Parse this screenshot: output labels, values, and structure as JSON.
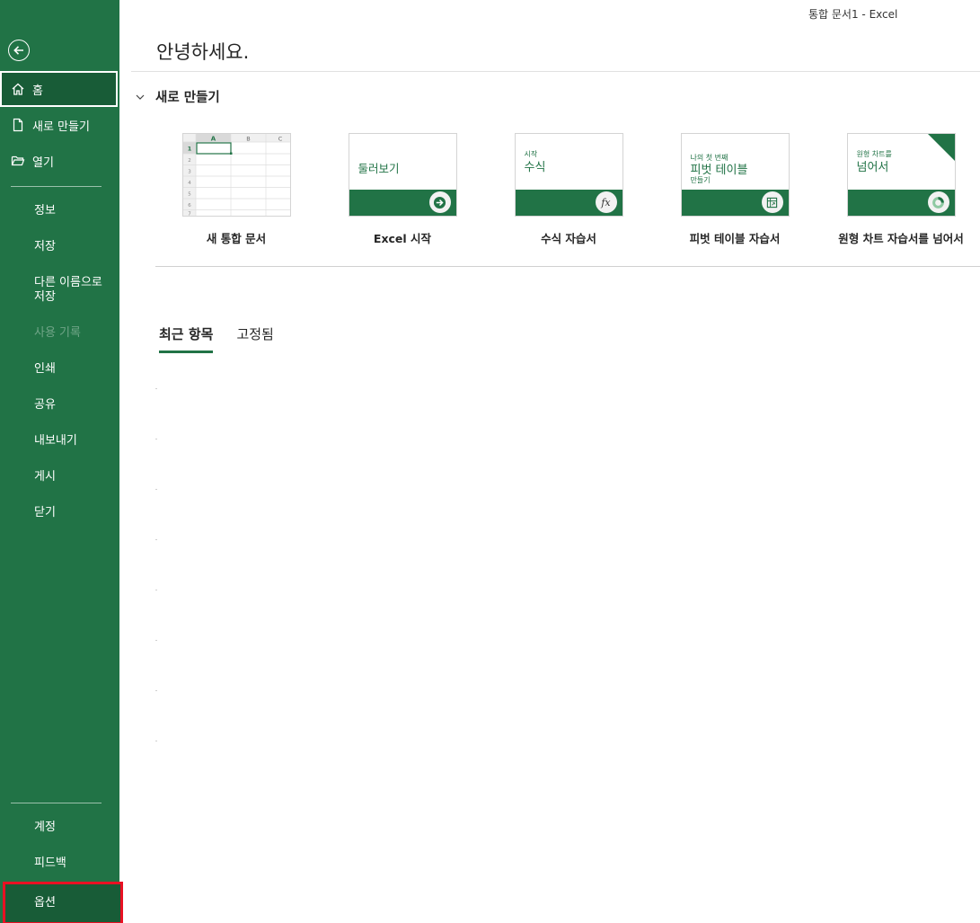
{
  "window": {
    "title": "통합 문서1  -  Excel"
  },
  "sidebar": {
    "top_items": [
      {
        "label": "홈",
        "icon": "home-icon",
        "active": true
      },
      {
        "label": "새로 만들기",
        "icon": "new-document-icon",
        "active": false
      },
      {
        "label": "열기",
        "icon": "open-folder-icon",
        "active": false
      }
    ],
    "mid_items": [
      {
        "label": "정보",
        "enabled": true
      },
      {
        "label": "저장",
        "enabled": true
      },
      {
        "label": "다른 이름으로 저장",
        "enabled": true
      },
      {
        "label": "사용 기록",
        "enabled": false
      },
      {
        "label": "인쇄",
        "enabled": true
      },
      {
        "label": "공유",
        "enabled": true
      },
      {
        "label": "내보내기",
        "enabled": true
      },
      {
        "label": "게시",
        "enabled": true
      },
      {
        "label": "닫기",
        "enabled": true
      }
    ],
    "bottom_items": [
      {
        "label": "계정"
      },
      {
        "label": "피드백"
      },
      {
        "label": "옵션",
        "highlighted": true
      }
    ]
  },
  "main": {
    "greeting": "안녕하세요.",
    "new_section": {
      "title": "새로 만들기"
    },
    "templates": [
      {
        "label": "새 통합 문서",
        "kind": "blank"
      },
      {
        "label": "Excel 시작",
        "kind": "tour",
        "thumb_text": "둘러보기"
      },
      {
        "label": "수식 자습서",
        "kind": "formula",
        "thumb_small": "시작",
        "thumb_big": "수식"
      },
      {
        "label": "피벗 테이블 자습서",
        "kind": "pivot",
        "thumb_small": "나의 첫 번째",
        "thumb_big": "피벗 테이블",
        "thumb_small2": "만들기"
      },
      {
        "label": "원형 차트 자습서를 넘어서",
        "kind": "pie",
        "thumb_small": "원형 차트를",
        "thumb_big": "넘어서"
      }
    ],
    "spreadsheet_thumb": {
      "columns": [
        "A",
        "B",
        "C"
      ],
      "rows": [
        "1",
        "2",
        "3",
        "4",
        "5",
        "6",
        "7"
      ]
    },
    "tabs": [
      {
        "label": "최근 항목",
        "active": true
      },
      {
        "label": "고정됨",
        "active": false
      }
    ]
  },
  "colors": {
    "excel_green": "#217346",
    "dark_green": "#185c37",
    "highlight_red": "#e81123"
  }
}
